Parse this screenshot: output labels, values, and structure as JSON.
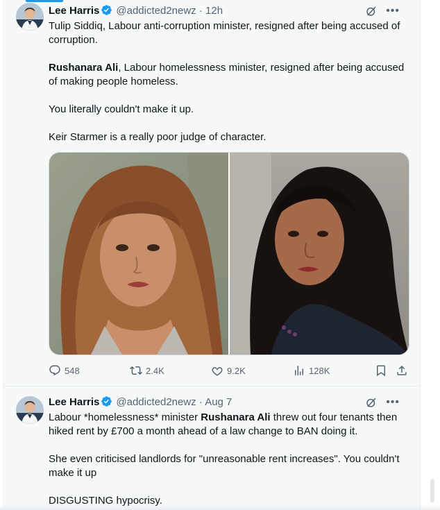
{
  "colors": {
    "accent": "#1d9bf0",
    "muted": "#536471",
    "text": "#0f1419"
  },
  "tweets": [
    {
      "author": {
        "name": "Lee Harris",
        "handle": "@addicted2newz",
        "time": "· 12h",
        "verified_icon": "verified-badge-icon"
      },
      "text": {
        "p1": "Tulip Siddiq, Labour anti-corruption minister, resigned after being accused of corruption.",
        "p2_bold": "Rushanara Ali",
        "p2_rest": ", Labour homelessness minister, resigned after being accused of making people homeless.",
        "p3": "You literally couldn't make it up.",
        "p4": "Keir Starmer is a really poor judge of character."
      },
      "media": [
        "photo-woman-light-brown-hair",
        "photo-woman-dark-hair"
      ],
      "stats": {
        "replies": "548",
        "reposts": "2.4K",
        "likes": "9.2K",
        "views": "128K"
      }
    },
    {
      "author": {
        "name": "Lee Harris",
        "handle": "@addicted2newz",
        "time": "· Aug 7",
        "verified_icon": "verified-badge-icon"
      },
      "text": {
        "p1_a": "Labour *homelessness* minister ",
        "p1_bold": "Rushanara Ali",
        "p1_b": " threw out four tenants then hiked rent by £700 a month ahead of a law change to BAN doing it.",
        "p2": "She even criticised landlords for \"unreasonable rent increases\". You couldn't make it up",
        "p3": "DISGUSTING hypocrisy."
      }
    }
  ],
  "icons": [
    "grok-icon",
    "more-icon",
    "reply-icon",
    "repost-icon",
    "like-icon",
    "views-icon",
    "bookmark-icon",
    "share-icon"
  ]
}
